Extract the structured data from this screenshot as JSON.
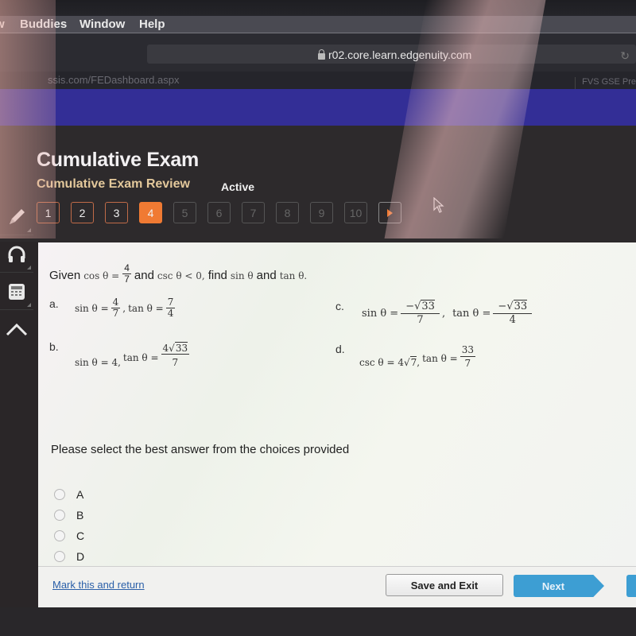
{
  "os_menubar": {
    "items": [
      "Buddies",
      "Window",
      "Help"
    ]
  },
  "browser": {
    "url": "r02.core.learn.edgenuity.com",
    "left_tab": "ssis.com/FEDashboard.aspx",
    "right_tab": "FVS GSE Pre"
  },
  "header": {
    "title": "Cumulative Exam",
    "subtitle": "Cumulative Exam Review",
    "status": "Active"
  },
  "question_nav": {
    "items": [
      {
        "label": "1",
        "state": "answered"
      },
      {
        "label": "2",
        "state": "answered"
      },
      {
        "label": "3",
        "state": "answered"
      },
      {
        "label": "4",
        "state": "current"
      },
      {
        "label": "5",
        "state": "future"
      },
      {
        "label": "6",
        "state": "future"
      },
      {
        "label": "7",
        "state": "future"
      },
      {
        "label": "8",
        "state": "future"
      },
      {
        "label": "9",
        "state": "future"
      },
      {
        "label": "10",
        "state": "future"
      }
    ],
    "next_icon": "play-arrow-icon"
  },
  "toolbar": {
    "tools": [
      {
        "name": "pencil-icon"
      },
      {
        "name": "headphones-icon"
      },
      {
        "name": "calculator-icon"
      },
      {
        "name": "collapse-up-icon"
      }
    ]
  },
  "question": {
    "prefix": "Given",
    "cos_lhs": "cos θ =",
    "cos_num": "4",
    "cos_den": "7",
    "and1": "and",
    "condition": "csc θ < 0,",
    "find": "find",
    "sin": "sin θ",
    "and2": "and",
    "tan": "tan θ."
  },
  "choices": {
    "a": {
      "label": "a.",
      "sin_lhs": "sin θ =",
      "sin_num": "4",
      "sin_den": "7",
      "sep": ",",
      "tan_lhs": "tan θ =",
      "tan_num": "7",
      "tan_den": "4"
    },
    "b": {
      "label": "b.",
      "sin_text": "sin θ = 4,",
      "tan_lhs": "tan θ =",
      "tan_num_coef": "4",
      "tan_num_rad": "33",
      "tan_den": "7"
    },
    "c": {
      "label": "c.",
      "sin_lhs": "sin θ =",
      "sin_num_sign": "−",
      "sin_num_rad": "33",
      "sin_den": "7",
      "sep": ",",
      "tan_lhs": "tan θ =",
      "tan_num_sign": "−",
      "tan_num_rad": "33",
      "tan_den": "4"
    },
    "d": {
      "label": "d.",
      "csc_text": "csc θ = 4",
      "csc_rad": "7",
      "sep": ",",
      "tan_lhs": "tan θ =",
      "tan_num": "33",
      "tan_den": "7"
    }
  },
  "instructions": "Please select the best answer from the choices provided",
  "answer_options": [
    "A",
    "B",
    "C",
    "D"
  ],
  "footer": {
    "mark_link": "Mark this and return",
    "save_exit": "Save and Exit",
    "next": "Next"
  },
  "colors": {
    "current_question": "#f07a33",
    "answered_border": "#c06b48",
    "next_button": "#3d9ed3",
    "banner": "#332e96",
    "subtitle": "#e3c89b"
  }
}
